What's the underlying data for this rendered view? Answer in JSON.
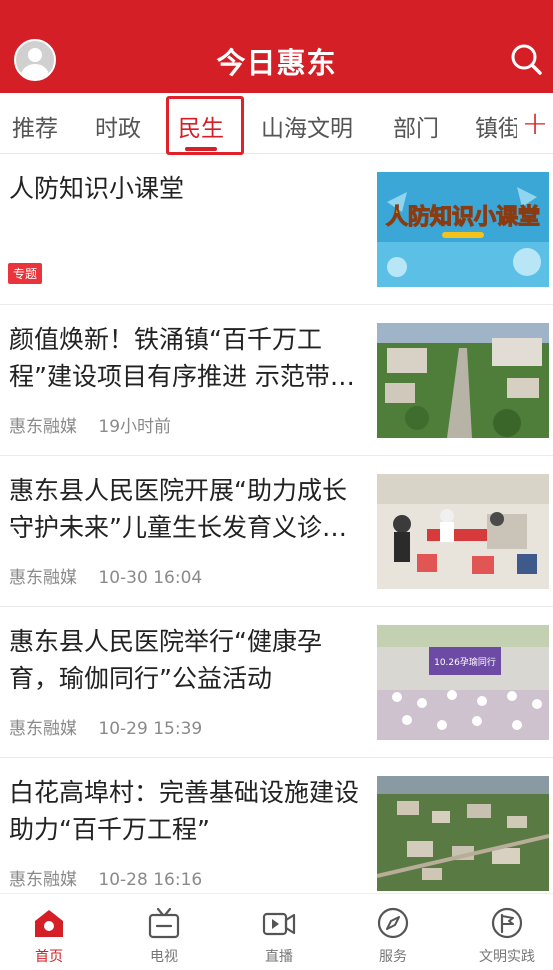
{
  "header": {
    "title": "今日惠东"
  },
  "tabs": [
    {
      "label": "推荐"
    },
    {
      "label": "时政"
    },
    {
      "label": "民生"
    },
    {
      "label": "山海文明"
    },
    {
      "label": "部门"
    },
    {
      "label": "镇街"
    }
  ],
  "feed": [
    {
      "headline": "人防知识小课堂",
      "tag": "专题"
    },
    {
      "headline": "颜值焕新！铁涌镇“百千万工程”建设项目有序推进 示范带建设",
      "source": "惠东融媒",
      "time": "19小时前"
    },
    {
      "headline": "惠东县人民医院开展“助力成长 守护未来”儿童生长发育义诊活动",
      "source": "惠东融媒",
      "time": "10-30 16:04"
    },
    {
      "headline": "惠东县人民医院举行“健康孕育，瑜伽同行”公益活动",
      "source": "惠东融媒",
      "time": "10-29 15:39"
    },
    {
      "headline": "白花高埠村：完善基础设施建设 助力“百千万工程”",
      "source": "惠东融媒",
      "time": "10-28 16:16"
    }
  ],
  "thumb_texts": {
    "quiz": "人防知识小课堂",
    "banner": "10.26孕瑜同行"
  },
  "bottom_nav": [
    {
      "label": "首页"
    },
    {
      "label": "电视"
    },
    {
      "label": "直播"
    },
    {
      "label": "服务"
    },
    {
      "label": "文明实践"
    }
  ],
  "colors": {
    "brand": "#d41f26",
    "meta": "#8a8a8a"
  }
}
